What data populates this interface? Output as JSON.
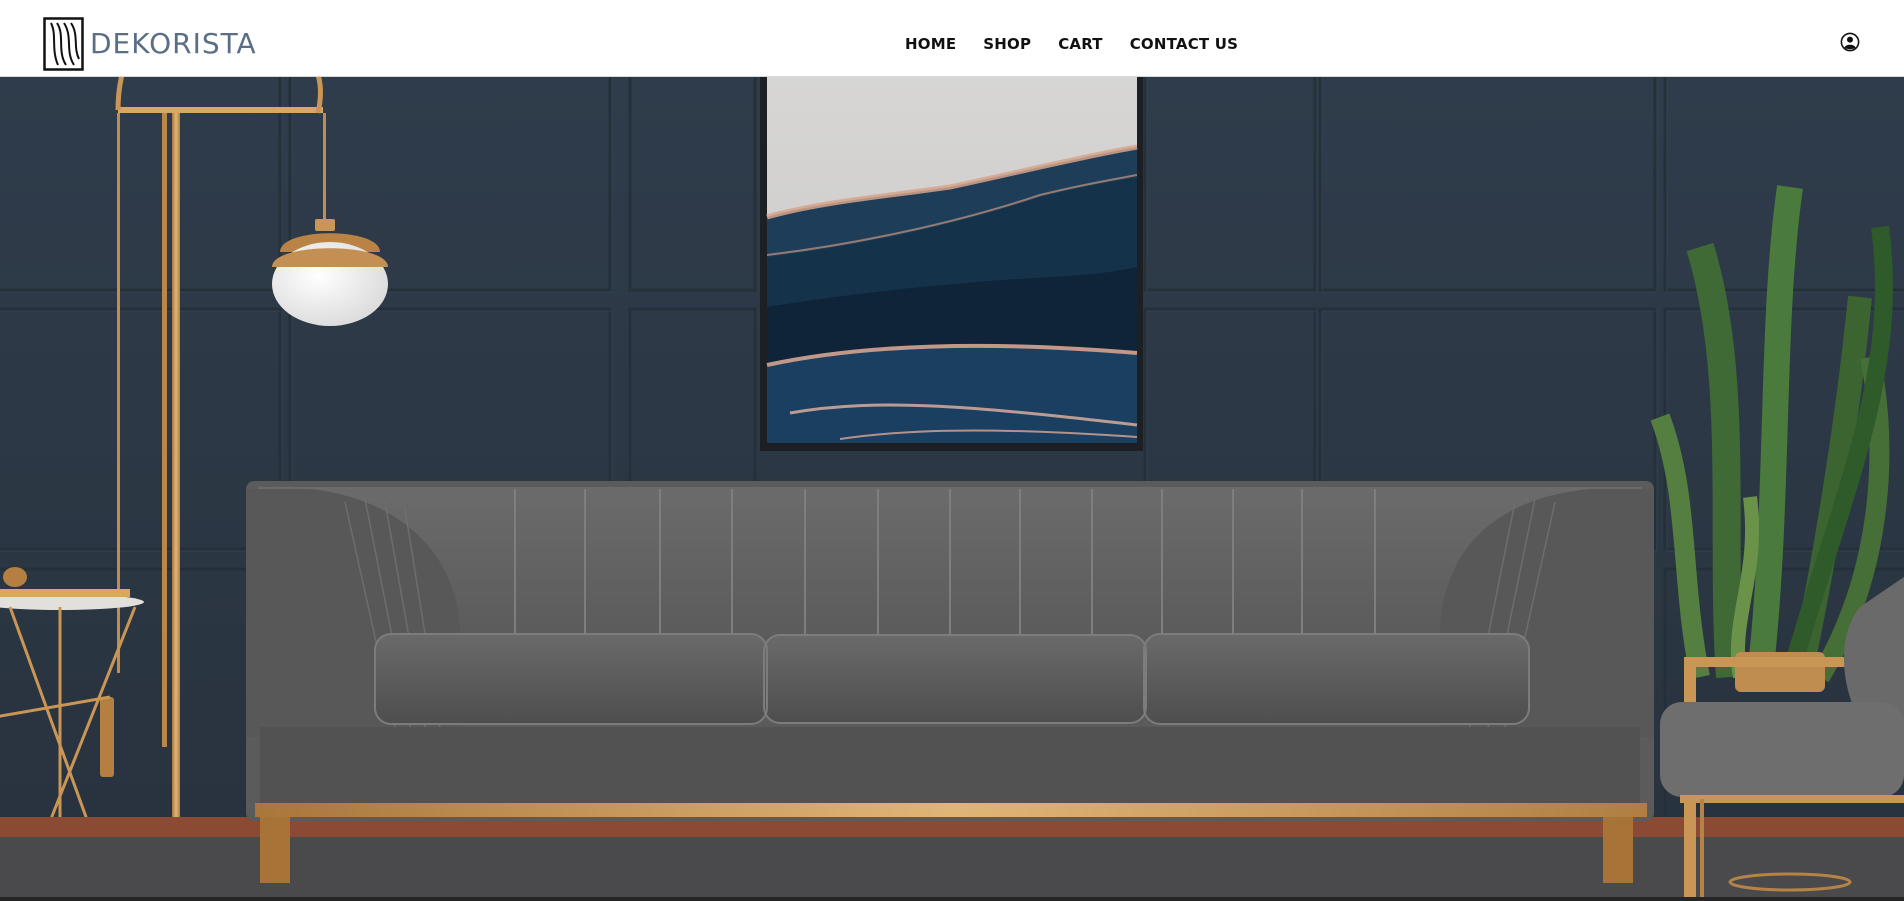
{
  "brand": {
    "name": "DEKORISTA"
  },
  "nav": {
    "items": [
      {
        "label": "HOME"
      },
      {
        "label": "SHOP"
      },
      {
        "label": "CART"
      },
      {
        "label": "CONTACT US"
      }
    ]
  },
  "header": {
    "account_icon": "user-account-icon"
  },
  "hero": {
    "scene": "living-room-hero-image",
    "colors": {
      "wall": "#2e3a48",
      "sofa": "#5f5f5f",
      "gold": "#c79a5d",
      "plant": "#3f6a35"
    }
  }
}
